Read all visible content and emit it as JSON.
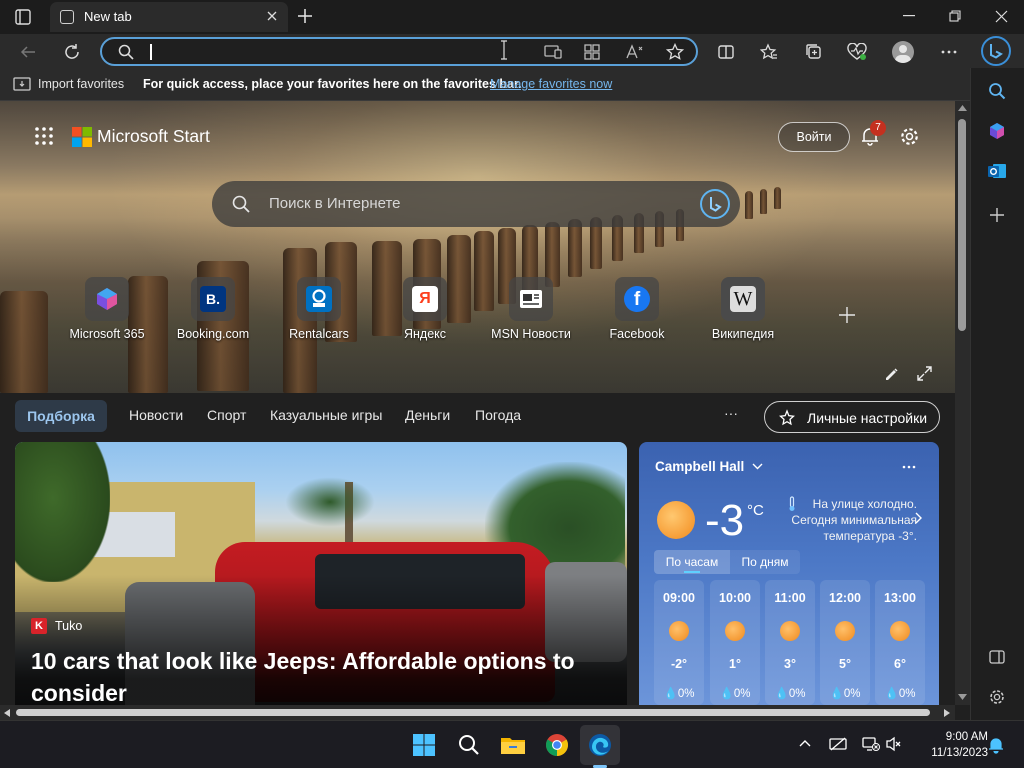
{
  "browser": {
    "tab_title": "New tab",
    "address_value": ""
  },
  "favorites_bar": {
    "import_label": "Import favorites",
    "message": "For quick access, place your favorites here on the favorites bar.",
    "manage_link": "Manage favorites now"
  },
  "start": {
    "logo": "Microsoft Start",
    "signin": "Войти",
    "notification_count": "7",
    "search_placeholder": "Поиск в Интернете",
    "quick_links": [
      {
        "label": "Microsoft 365",
        "icon": "microsoft-365-icon"
      },
      {
        "label": "Booking.com",
        "icon": "booking-icon",
        "glyph": "B."
      },
      {
        "label": "Rentalcars",
        "icon": "rentalcars-icon"
      },
      {
        "label": "Яндекс",
        "icon": "yandex-icon",
        "glyph": "Я"
      },
      {
        "label": "MSN Новости",
        "icon": "msn-news-icon"
      },
      {
        "label": "Facebook",
        "icon": "facebook-icon",
        "glyph": "f"
      },
      {
        "label": "Википедия",
        "icon": "wikipedia-icon",
        "glyph": "W"
      }
    ]
  },
  "nav": {
    "active": "Подборка",
    "items": [
      "Новости",
      "Спорт",
      "Казуальные игры",
      "Деньги",
      "Погода"
    ],
    "more": "···",
    "personalize": "Личные настройки"
  },
  "news": {
    "source": "Tuko",
    "source_glyph": "K",
    "headline": "10 cars that look like Jeeps: Affordable options to consider"
  },
  "weather": {
    "location": "Campbell Hall",
    "temperature": "-3",
    "unit": "°C",
    "description": "На улице холодно. Сегодня минимальная температура -3°.",
    "tabs": [
      "По часам",
      "По дням"
    ],
    "hourly": [
      {
        "time": "09:00",
        "temp": "-2°",
        "precip": "0%"
      },
      {
        "time": "10:00",
        "temp": "1°",
        "precip": "0%"
      },
      {
        "time": "11:00",
        "temp": "3°",
        "precip": "0%"
      },
      {
        "time": "12:00",
        "temp": "5°",
        "precip": "0%"
      },
      {
        "time": "13:00",
        "temp": "6°",
        "precip": "0%"
      }
    ]
  },
  "taskbar": {
    "time": "9:00 AM",
    "date": "11/13/2023"
  },
  "colors": {
    "accent": "#5aa0d8",
    "link": "#75b6ec",
    "weather_bg": "#4c78c6",
    "badge": "#c4301f"
  }
}
